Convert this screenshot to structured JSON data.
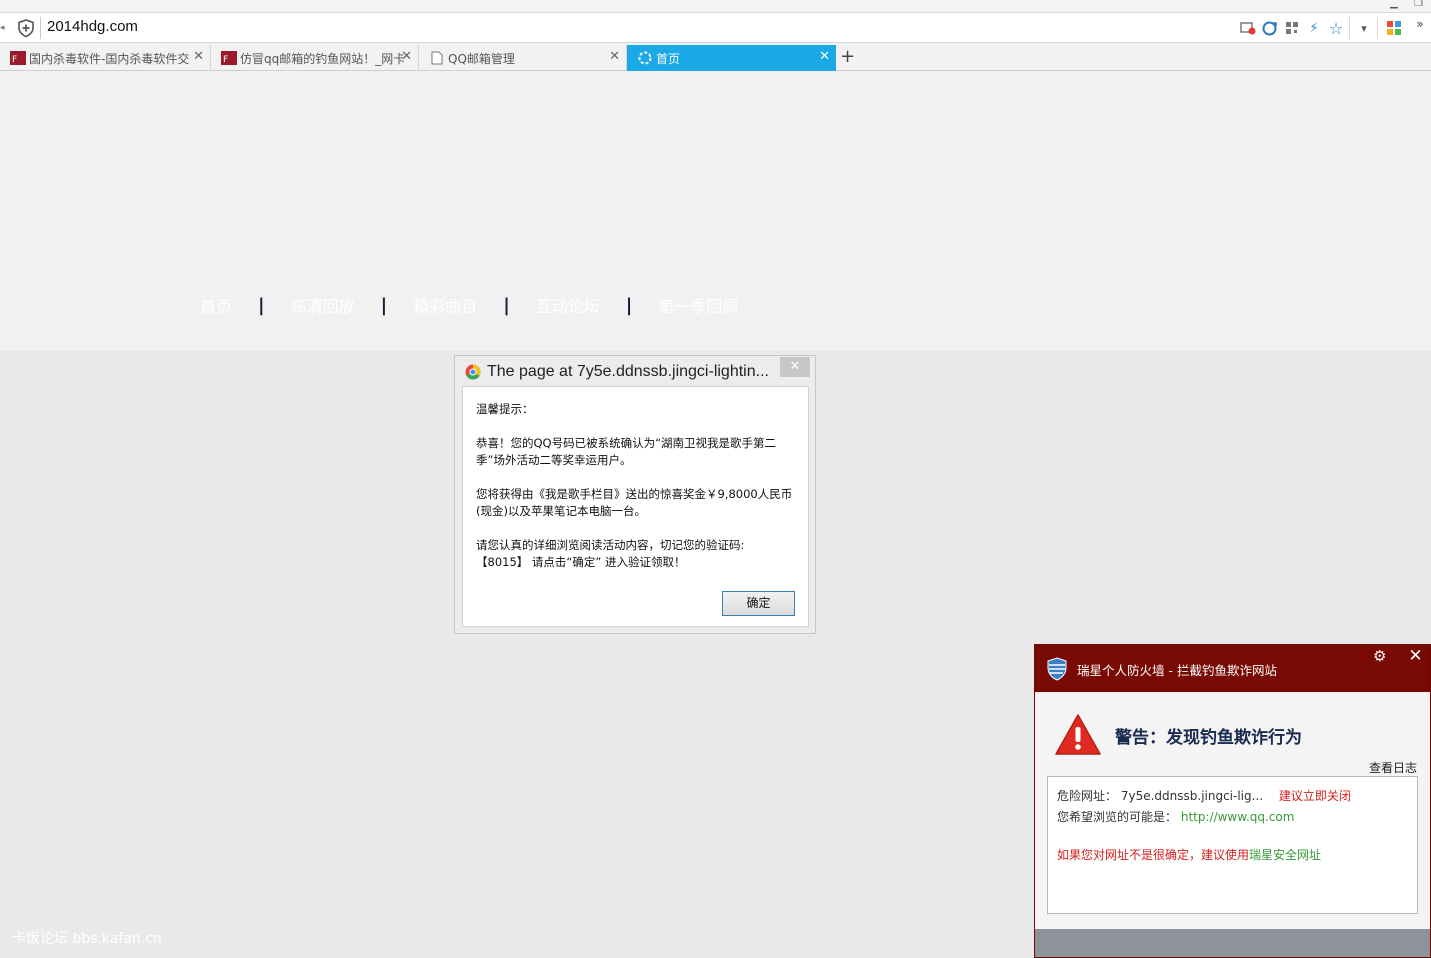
{
  "browser": {
    "url": "2014hdg.com",
    "tabs": [
      {
        "label": "国内杀毒软件-国内杀毒软件交",
        "favicon": "site-icon",
        "active": false
      },
      {
        "label": "仿冒qq邮箱的钓鱼网站！_网卡",
        "favicon": "site-icon",
        "active": false
      },
      {
        "label": "QQ邮箱管理",
        "favicon": "page-icon",
        "active": false
      },
      {
        "label": "首页",
        "favicon": "loading-icon",
        "active": true
      }
    ],
    "new_tab": "+",
    "accent": "#1aa9e6"
  },
  "page": {
    "nav": [
      "首页",
      "高清回放",
      "精彩曲目",
      "互动论坛",
      "第一季回顾"
    ],
    "nav_divider": "|",
    "watermark": "卡饭论坛 bbs.kafan.cn"
  },
  "dialog": {
    "title": "The page at 7y5e.ddnssb.jingci-lightin...",
    "close": "✕",
    "paragraphs": [
      "温馨提示：",
      "恭喜！您的QQ号码已被系统确认为“湖南卫视我是歌手第二季”场外活动二等奖幸运用户。",
      "您将获得由《我是歌手栏目》送出的惊喜奖金￥9,8000人民币(现金)以及苹果笔记本电脑一台。"
    ],
    "line_a": "请您认真的详细浏览阅读活动内容，切记您的验证码:",
    "line_b": "【8015】 请点击“确定” 进入验证领取！",
    "ok_label": "确定"
  },
  "firewall": {
    "title": "瑞星个人防火墙 - 拦截钓鱼欺诈网站",
    "headline": "警告：发现钓鱼欺诈行为",
    "view_log": "查看日志",
    "danger_label": "危险网址：",
    "danger_url": "7y5e.ddnssb.jingci-lig...",
    "close_advice": "建议立即关闭",
    "expected_label": "您希望浏览的可能是：",
    "expected_url": "http://www.qq.com",
    "unsure_text": "如果您对网址不是很确定，建议使用",
    "safe_link": "瑞星安全网址",
    "header_color": "#780a03"
  }
}
